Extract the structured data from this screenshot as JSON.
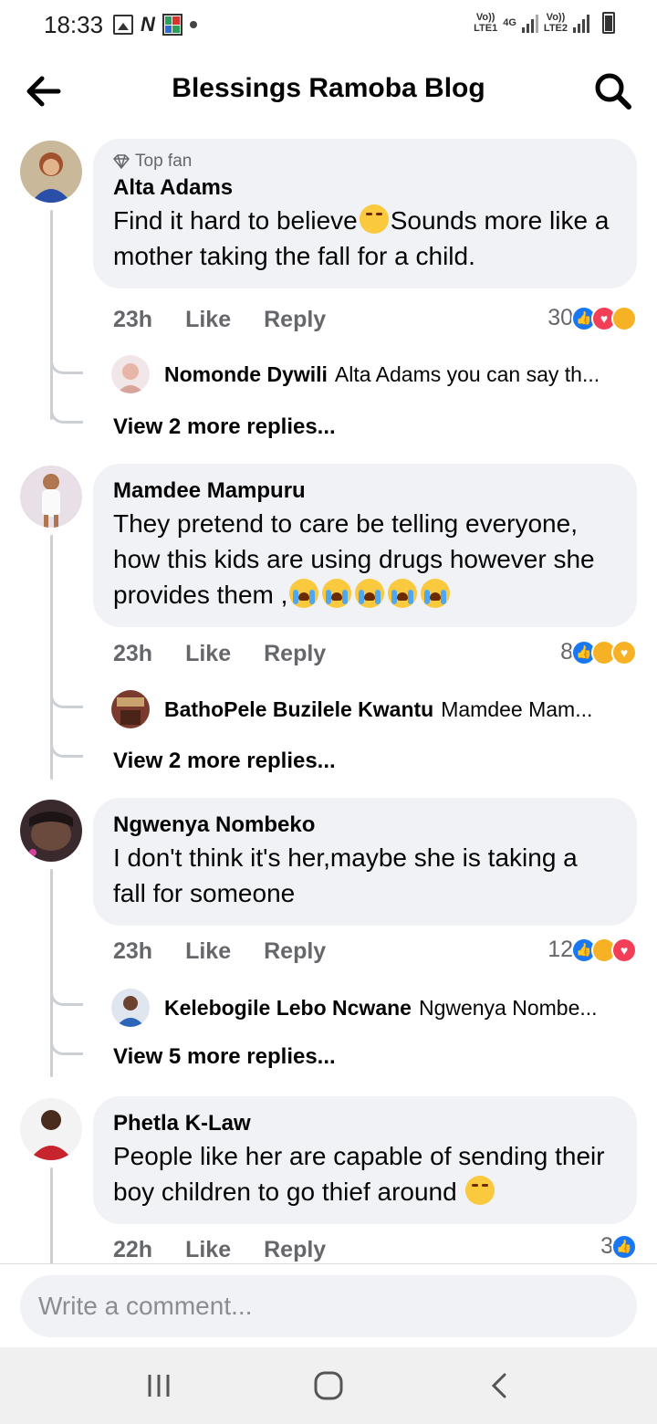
{
  "status_bar": {
    "time": "18:33",
    "net1_top": "Vo))",
    "net1_bottom": "LTE1",
    "net_type": "4G",
    "net2_top": "Vo))",
    "net2_bottom": "LTE2"
  },
  "header": {
    "title": "Blessings Ramoba Blog"
  },
  "comments": [
    {
      "badge": "Top fan",
      "author": "Alta Adams",
      "text_a": "Find it hard to believe",
      "text_b": "Sounds more like a mother taking the fall for a child.",
      "time": "23h",
      "like": "Like",
      "reply": "Reply",
      "reaction_count": "30",
      "reactions": [
        "like-icon",
        "love-icon",
        "sad-icon"
      ],
      "reply_author": "Nomonde Dywili",
      "reply_snippet": "Alta Adams you can say th...",
      "view_more": "View 2 more replies..."
    },
    {
      "author": "Mamdee Mampuru",
      "text": "They pretend to care be telling everyone, how this kids are using drugs however she provides them ,",
      "time": "23h",
      "like": "Like",
      "reply": "Reply",
      "reaction_count": "8",
      "reactions": [
        "like-icon",
        "sad-icon",
        "care-icon"
      ],
      "reply_author": "BathoPele Buzilele Kwantu",
      "reply_snippet": "Mamdee Mam...",
      "view_more": "View 2 more replies..."
    },
    {
      "author": "Ngwenya Nombeko",
      "text": "I don't think it's her,maybe she is taking a fall for someone",
      "time": "23h",
      "like": "Like",
      "reply": "Reply",
      "reaction_count": "12",
      "reactions": [
        "like-icon",
        "haha-icon",
        "love-icon"
      ],
      "reply_author": "Kelebogile Lebo Ncwane",
      "reply_snippet": "Ngwenya Nombe...",
      "view_more": "View 5 more replies..."
    },
    {
      "author": "Phetla K-Law",
      "text": "People like her are capable of sending their boy children to go thief around",
      "time": "22h",
      "like": "Like",
      "reply": "Reply",
      "reaction_count": "3",
      "reactions": [
        "like-icon"
      ]
    }
  ],
  "composer": {
    "placeholder": "Write a comment..."
  },
  "colors": {
    "bubble": "#f0f2f5",
    "meta_text": "#65676b",
    "like_blue": "#1877f2",
    "love_red": "#f33e58"
  }
}
